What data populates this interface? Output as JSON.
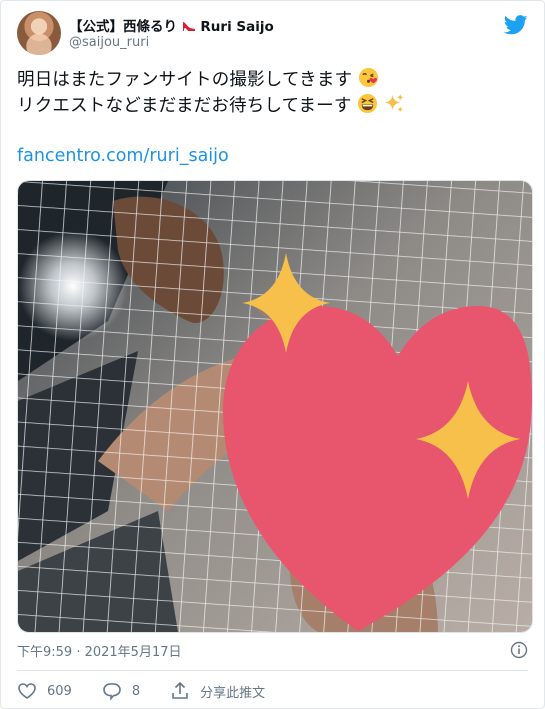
{
  "tweet": {
    "author_name": "【公式】西條るり",
    "author_name_suffix": "Ruri Saijo",
    "author_handle": "@saijou_ruri",
    "text_line1": "明日はまたファンサイトの撮影してきます",
    "text_line2": "リクエストなどまだまだお待ちしてまーす",
    "link": "fancentro.com/ruri_saijo",
    "timestamp": "下午9:59 · 2021年5月17日"
  },
  "actions": {
    "likes": "609",
    "replies": "8",
    "share_label": "分享此推文"
  },
  "icons": {
    "brand": "twitter-bird-icon",
    "info": "info-icon",
    "like": "heart-icon",
    "reply": "comment-icon",
    "share": "share-icon",
    "emoji1": "kissing-face-icon",
    "emoji2": "grinning-squinting-face-icon",
    "emoji3": "sparkles-icon",
    "sticker": "sparkling-heart-sticker"
  },
  "colors": {
    "accent": "#1b95e0",
    "brand": "#1da1f2",
    "secondary_text": "#657786",
    "heart_sticker": "#e8566e",
    "sparkle": "#f7c04a"
  }
}
